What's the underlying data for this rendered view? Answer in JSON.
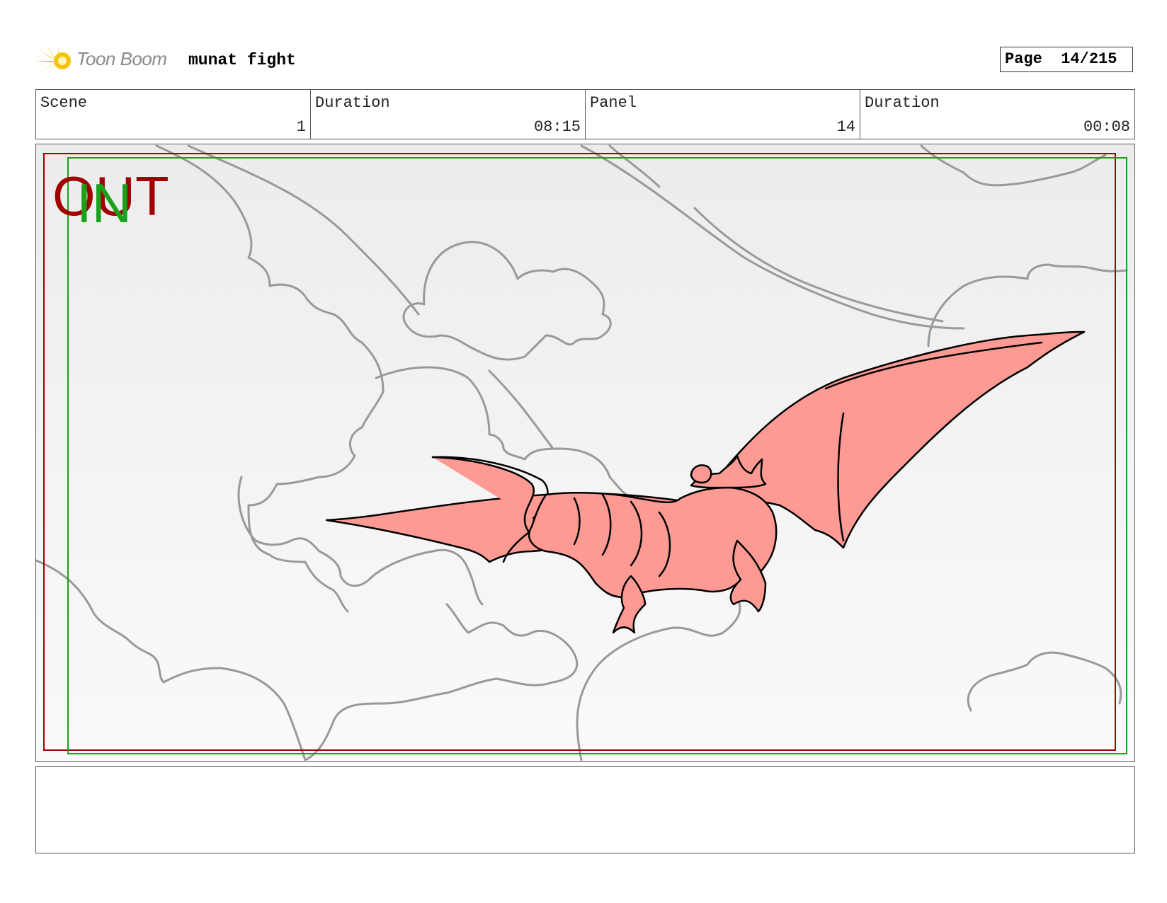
{
  "header": {
    "logo_text": "Toon Boom",
    "project_title": "munat fight",
    "page_label": "Page",
    "page_value": "14/215"
  },
  "info": {
    "scene_label": "Scene",
    "scene_value": "1",
    "scene_duration_label": "Duration",
    "scene_duration_value": "08:15",
    "panel_label": "Panel",
    "panel_value": "14",
    "panel_duration_label": "Duration",
    "panel_duration_value": "00:08"
  },
  "panel": {
    "out_marker": "OUT",
    "in_marker": "IN",
    "out_color": "#a00000",
    "in_color": "#1aa01a",
    "creature_fill": "#fc9a93",
    "sketch_line": "#999999"
  },
  "colors": {
    "logo_accent": "#f5c400"
  }
}
